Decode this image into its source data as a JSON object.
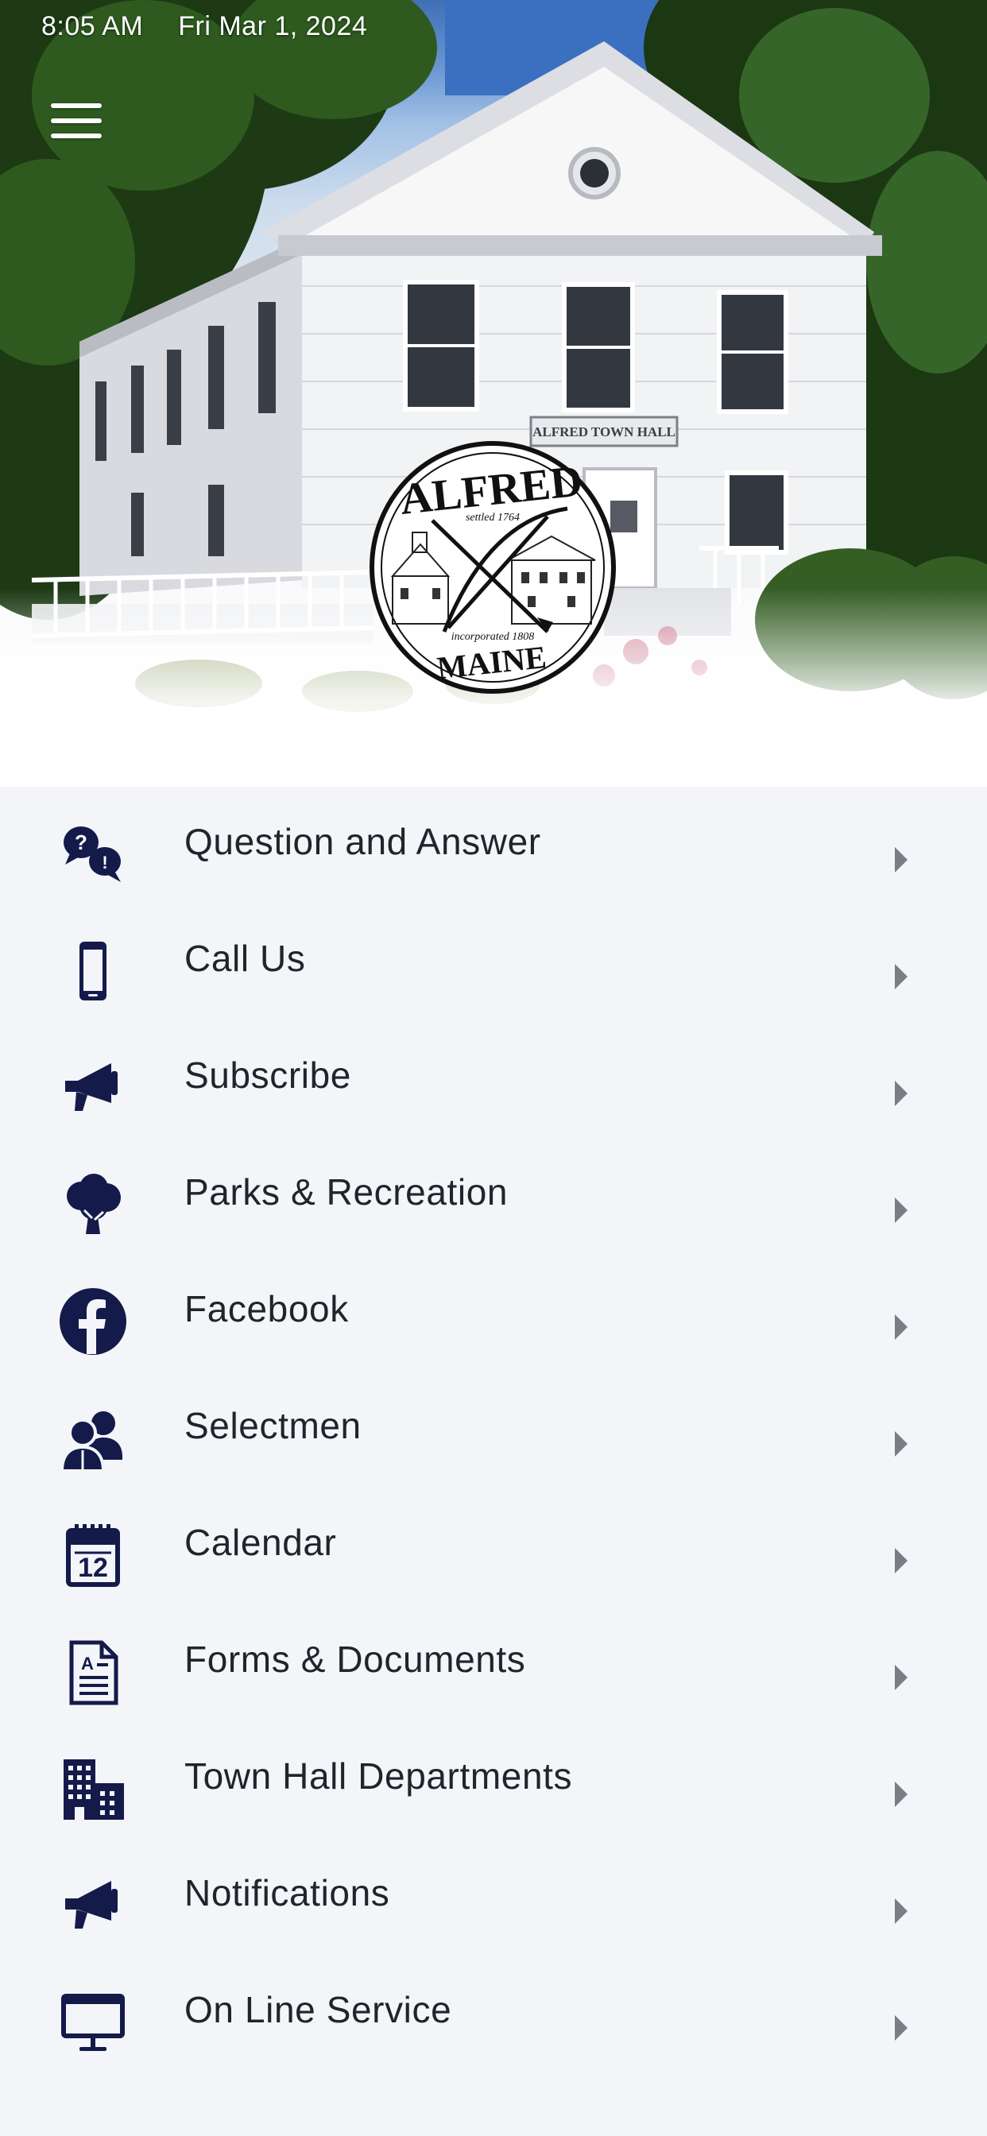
{
  "status_bar": {
    "time": "8:05 AM",
    "date": "Fri Mar 1, 2024"
  },
  "hero": {
    "building_sign": "ALFRED TOWN HALL",
    "seal": {
      "name": "ALFRED",
      "settled": "settled 1764",
      "incorporated": "incorporated 1808",
      "state": "MAINE"
    }
  },
  "colors": {
    "icon": "#141a4a",
    "text": "#22242c",
    "chevron": "#7b7d85",
    "background": "#f4f5f8"
  },
  "menu": [
    {
      "label": "Question and Answer",
      "icon": "question-bubbles-icon"
    },
    {
      "label": "Call Us",
      "icon": "mobile-phone-icon"
    },
    {
      "label": "Subscribe",
      "icon": "megaphone-icon"
    },
    {
      "label": "Parks & Recreation",
      "icon": "tree-icon"
    },
    {
      "label": "Facebook",
      "icon": "facebook-icon"
    },
    {
      "label": "Selectmen",
      "icon": "people-icon"
    },
    {
      "label": "Calendar",
      "icon": "calendar-icon"
    },
    {
      "label": "Forms & Documents",
      "icon": "document-icon"
    },
    {
      "label": "Town Hall Departments",
      "icon": "buildings-icon"
    },
    {
      "label": "Notifications",
      "icon": "megaphone-icon"
    },
    {
      "label": "On Line Service",
      "icon": "monitor-icon"
    }
  ]
}
